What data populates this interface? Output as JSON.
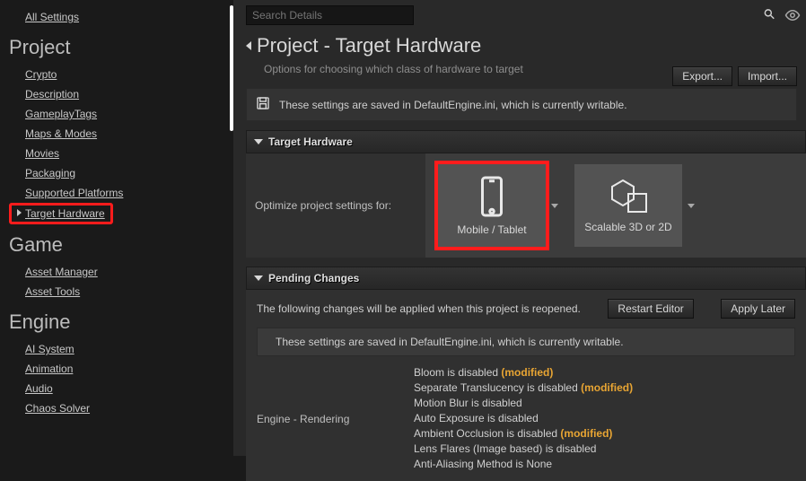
{
  "sidebar": {
    "all_settings": "All Settings",
    "sections": {
      "project": {
        "label": "Project",
        "items": [
          "Crypto",
          "Description",
          "GameplayTags",
          "Maps & Modes",
          "Movies",
          "Packaging",
          "Supported Platforms",
          "Target Hardware"
        ]
      },
      "game": {
        "label": "Game",
        "items": [
          "Asset Manager",
          "Asset Tools"
        ]
      },
      "engine": {
        "label": "Engine",
        "items": [
          "AI System",
          "Animation",
          "Audio",
          "Chaos Solver"
        ]
      }
    }
  },
  "search": {
    "placeholder": "Search Details"
  },
  "header": {
    "title": "Project - Target Hardware",
    "subtitle": "Options for choosing which class of hardware to target",
    "export": "Export...",
    "import": "Import..."
  },
  "notice": "These settings are saved in DefaultEngine.ini, which is currently writable.",
  "target_hardware_section": {
    "label": "Target Hardware",
    "optimize_label": "Optimize project settings for:",
    "card_mobile": "Mobile / Tablet",
    "card_scalable": "Scalable 3D or 2D"
  },
  "pending": {
    "label": "Pending Changes",
    "msg": "The following changes will be applied when this project is reopened.",
    "restart": "Restart Editor",
    "apply_later": "Apply Later",
    "notice": "These settings are saved in DefaultEngine.ini, which is currently writable.",
    "engine_rendering": {
      "label": "Engine - Rendering",
      "lines": [
        {
          "t": "Bloom is disabled ",
          "m": "(modified)"
        },
        {
          "t": "Separate Translucency is disabled ",
          "m": "(modified)"
        },
        {
          "t": "Motion Blur is disabled",
          "m": ""
        },
        {
          "t": "Auto Exposure is disabled",
          "m": ""
        },
        {
          "t": "Ambient Occlusion is disabled ",
          "m": "(modified)"
        },
        {
          "t": "Lens Flares (Image based) is disabled",
          "m": ""
        },
        {
          "t": "Anti-Aliasing Method is None",
          "m": ""
        }
      ]
    }
  }
}
